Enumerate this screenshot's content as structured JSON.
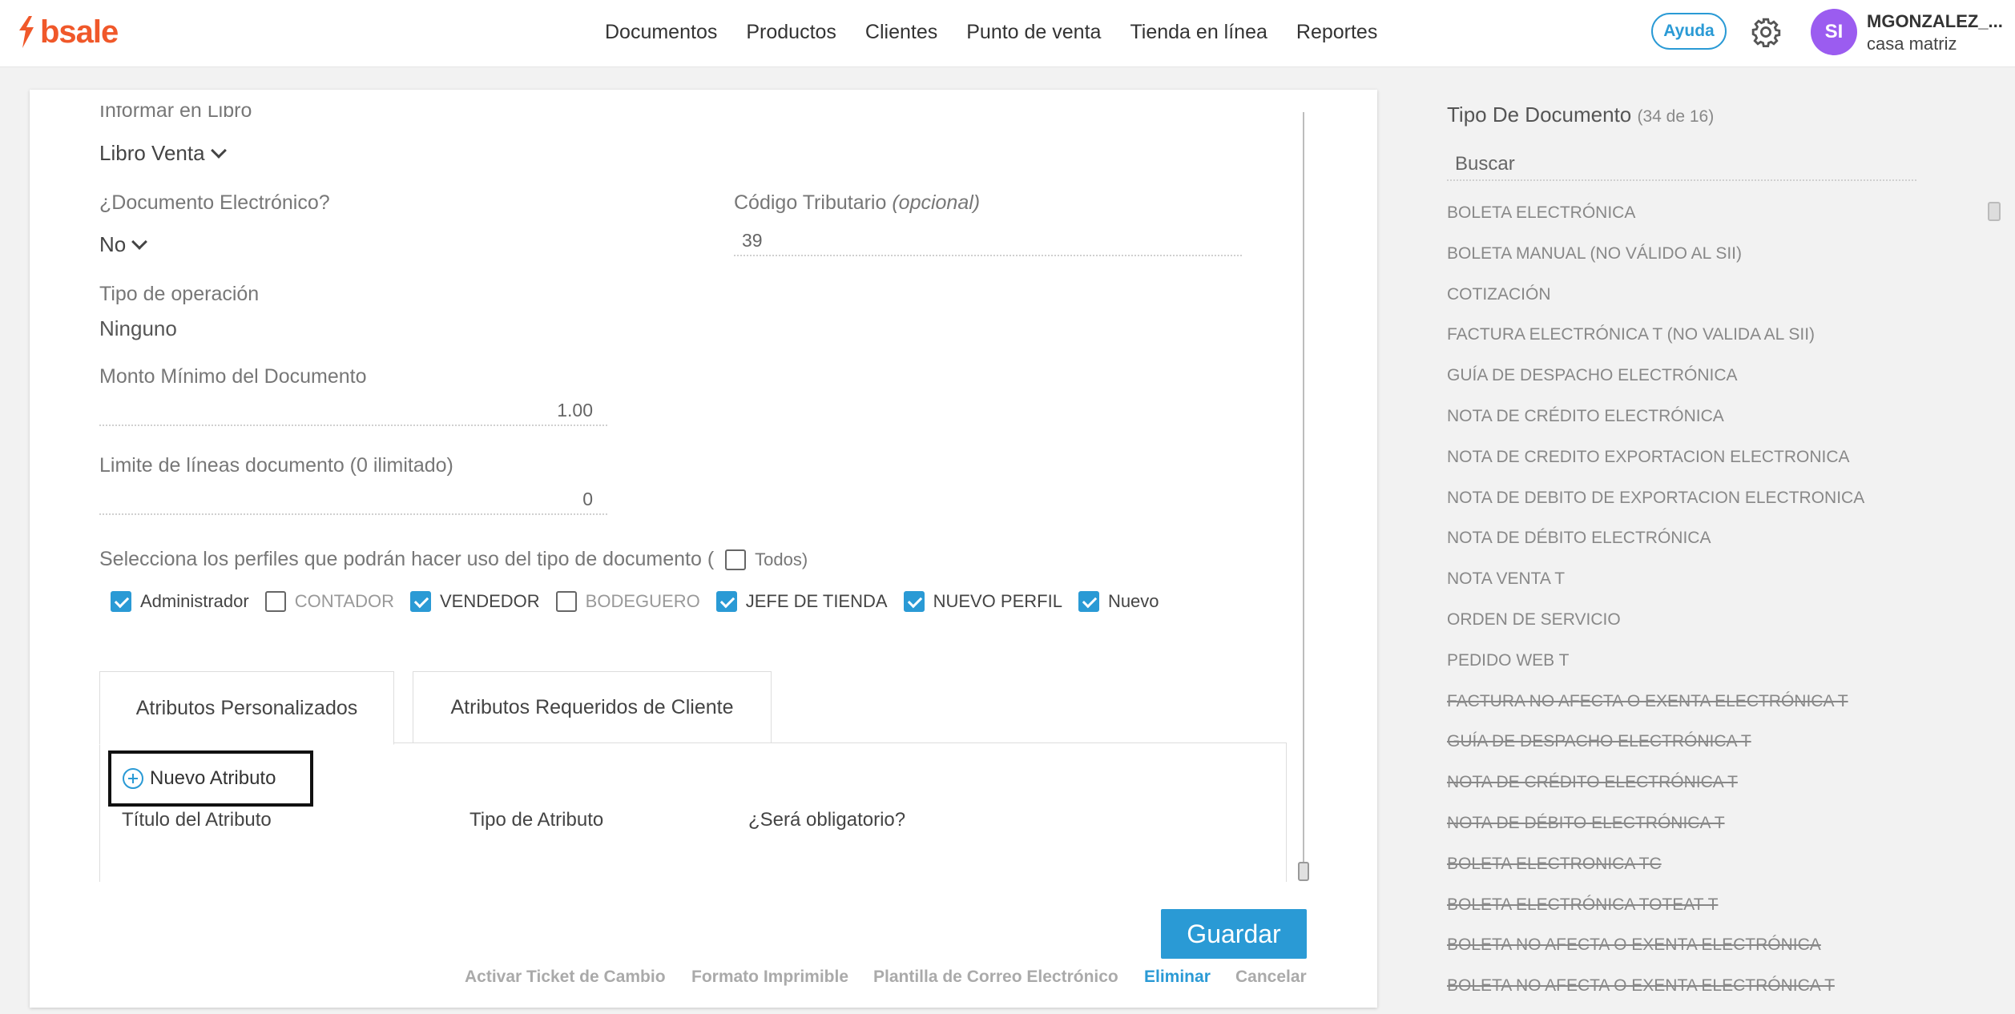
{
  "header": {
    "logo_text": "bsale",
    "nav": [
      "Documentos",
      "Productos",
      "Clientes",
      "Punto de venta",
      "Tienda en línea",
      "Reportes"
    ],
    "help_label": "Ayuda",
    "avatar_initials": "SI",
    "user_name": "MGONZALEZ_...",
    "user_branch": "casa matriz",
    "brand_color": "#f0582a",
    "accent_color": "#2a9ad5"
  },
  "form": {
    "libro_label": "Informar en Libro",
    "libro_value": "Libro Venta",
    "electronic_label": "¿Documento Electrónico?",
    "electronic_value": "No",
    "codigo_label": "Código Tributario",
    "codigo_optional": "(opcional)",
    "codigo_value": "39",
    "operacion_label": "Tipo de operación",
    "operacion_value": "Ninguno",
    "monto_label": "Monto Mínimo del Documento",
    "monto_value": "1.00",
    "limite_label": "Limite de líneas documento (0 ilimitado)",
    "limite_value": "0",
    "perfiles_label": "Selecciona los perfiles que podrán hacer uso del tipo de documento (",
    "todos_label": "Todos)",
    "profiles": [
      {
        "label": "Administrador",
        "checked": true
      },
      {
        "label": "CONTADOR",
        "checked": false
      },
      {
        "label": "VENDEDOR",
        "checked": true
      },
      {
        "label": "BODEGUERO",
        "checked": false
      },
      {
        "label": "JEFE DE TIENDA",
        "checked": true
      },
      {
        "label": "NUEVO PERFIL",
        "checked": true
      },
      {
        "label": "Nuevo",
        "checked": true
      }
    ]
  },
  "tabs": {
    "custom": "Atributos Personalizados",
    "client": "Atributos Requeridos de Cliente"
  },
  "attributes": {
    "new_button": "Nuevo Atributo",
    "col_title": "Título del Atributo",
    "col_type": "Tipo de Atributo",
    "col_required": "¿Será obligatorio?"
  },
  "actions": {
    "save": "Guardar",
    "ticket": "Activar Ticket de Cambio",
    "print_format": "Formato Imprimible",
    "email_template": "Plantilla de Correo Electrónico",
    "delete": "Eliminar",
    "cancel": "Cancelar"
  },
  "doc_types": {
    "title": "Tipo De Documento",
    "count": "(34 de 16)",
    "search_placeholder": "Buscar",
    "items": [
      {
        "label": "BOLETA ELECTRÓNICA",
        "disabled": false
      },
      {
        "label": "BOLETA MANUAL (NO VÁLIDO AL SII)",
        "disabled": false
      },
      {
        "label": "COTIZACIÓN",
        "disabled": false
      },
      {
        "label": "FACTURA ELECTRÓNICA T (NO VALIDA AL SII)",
        "disabled": false
      },
      {
        "label": "GUÍA DE DESPACHO ELECTRÓNICA",
        "disabled": false
      },
      {
        "label": "NOTA DE CRÉDITO ELECTRÓNICA",
        "disabled": false
      },
      {
        "label": "NOTA DE CREDITO EXPORTACION ELECTRONICA",
        "disabled": false
      },
      {
        "label": "NOTA DE DEBITO DE EXPORTACION ELECTRONICA",
        "disabled": false
      },
      {
        "label": "NOTA DE DÉBITO ELECTRÓNICA",
        "disabled": false
      },
      {
        "label": "NOTA VENTA T",
        "disabled": false
      },
      {
        "label": "ORDEN DE SERVICIO",
        "disabled": false
      },
      {
        "label": "PEDIDO WEB T",
        "disabled": false
      },
      {
        "label": "FACTURA NO AFECTA O EXENTA ELECTRÓNICA T",
        "disabled": true
      },
      {
        "label": "GUÍA DE DESPACHO ELECTRÓNICA T",
        "disabled": true
      },
      {
        "label": "NOTA DE CRÉDITO ELECTRÓNICA T",
        "disabled": true
      },
      {
        "label": "NOTA DE DÉBITO ELECTRÓNICA T",
        "disabled": true
      },
      {
        "label": "BOLETA ELECTRONICA TC",
        "disabled": true
      },
      {
        "label": "BOLETA ELECTRÓNICA TOTEAT T",
        "disabled": true
      },
      {
        "label": "BOLETA NO AFECTA O EXENTA ELECTRÓNICA",
        "disabled": true
      },
      {
        "label": "BOLETA NO AFECTA O EXENTA ELECTRÓNICA T",
        "disabled": true
      }
    ]
  }
}
